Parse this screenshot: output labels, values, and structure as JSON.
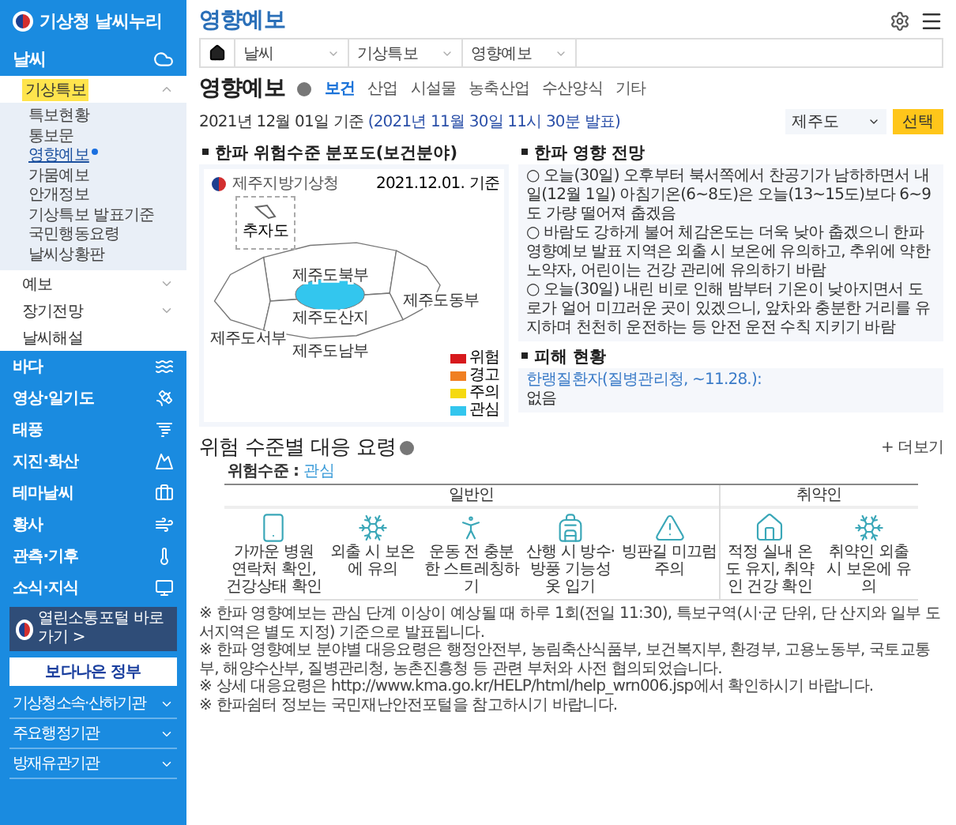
{
  "sidebar": {
    "logo": "기상청 날씨누리",
    "section": "날씨",
    "groups": [
      {
        "kind": "menu",
        "label": "기상특보",
        "expanded": true,
        "children": [
          {
            "label": "특보현황",
            "selected": false
          },
          {
            "label": "통보문",
            "selected": false
          },
          {
            "label": "영향예보",
            "selected": true
          },
          {
            "label": "가뭄예보",
            "selected": false
          },
          {
            "label": "안개정보",
            "selected": false
          },
          {
            "label": "기상특보 발표기준",
            "selected": false
          },
          {
            "label": "국민행동요령",
            "selected": false
          },
          {
            "label": "날씨상황판",
            "selected": false
          }
        ]
      },
      {
        "kind": "menu",
        "label": "예보",
        "expanded": false
      },
      {
        "kind": "menu",
        "label": "장기전망",
        "expanded": false
      },
      {
        "kind": "link",
        "label": "날씨해설"
      }
    ],
    "categories": [
      "바다",
      "영상·일기도",
      "태풍",
      "지진·화산",
      "테마날씨",
      "황사",
      "관측·기후",
      "소식·지식"
    ],
    "banners": [
      {
        "kind": "dark",
        "text": "열린소통포털 바로가기 >"
      },
      {
        "kind": "light",
        "text": "보다나은 정부"
      }
    ],
    "links": [
      "기상청소속·산하기관",
      "주요행정기관",
      "방재유관기관"
    ]
  },
  "main": {
    "page_title": "영향예보",
    "breadcrumb": [
      "날씨",
      "기상특보",
      "영향예보"
    ],
    "heading": "영향예보",
    "tabs": [
      {
        "label": "보건",
        "selected": true
      },
      {
        "label": "산업",
        "selected": false
      },
      {
        "label": "시설물",
        "selected": false
      },
      {
        "label": "농축산업",
        "selected": false
      },
      {
        "label": "수산양식",
        "selected": false
      },
      {
        "label": "기타",
        "selected": false
      }
    ],
    "date_basis": "2021년 12월 01일 기준",
    "issued": "(2021년 11월 30일 11시 30분 발표)",
    "region_select": {
      "value": "제주도"
    },
    "select_button": "선택",
    "map_panel": {
      "title": "한파 위험수준 분포도(보건분야)",
      "agency": "제주지방기상청",
      "date": "2021.12.01. 기준",
      "inset_label": "추자도",
      "regions": [
        {
          "label": "제주도북부",
          "color": "#ffffff"
        },
        {
          "label": "제주도동부",
          "color": "#ffffff"
        },
        {
          "label": "제주도산지",
          "color": "#33c6ee"
        },
        {
          "label": "제주도서부",
          "color": "#ffffff"
        },
        {
          "label": "제주도남부",
          "color": "#ffffff"
        }
      ],
      "legend": [
        {
          "label": "위험",
          "color": "#d7191c"
        },
        {
          "label": "경고",
          "color": "#f07f22"
        },
        {
          "label": "주의",
          "color": "#f5d90f"
        },
        {
          "label": "관심",
          "color": "#33c6ee"
        }
      ]
    },
    "outlook": {
      "title": "한파 영향 전망",
      "items": [
        "○ 오늘(30일) 오후부터 북서쪽에서 찬공기가 남하하면서 내일(12월 1일) 아침기온(6~8도)은 오늘(13~15도)보다 6~9도 가량 떨어져 춥겠음",
        "○ 바람도 강하게 불어 체감온도는 더욱 낮아 춥겠으니 한파 영향예보 발표 지역은 외출 시 보온에 유의하고, 추위에 약한 노약자, 어린이는 건강 관리에 유의하기 바람",
        "○ 오늘(30일) 내린 비로 인해 밤부터 기온이 낮아지면서 도로가 얼어 미끄러운 곳이 있겠으니, 앞차와 충분한 거리를 유지하며 천천히 운전하는 등 안전 운전 수칙 지키기 바람"
      ]
    },
    "damage": {
      "title": "피해 현황",
      "link": "한랭질환자(질병관리청, ~11.28.):",
      "value": "없음"
    },
    "guide": {
      "title": "위험 수준별 대응 요령",
      "more": "+ 더보기",
      "level_label": "위험수준 :",
      "level": "관심",
      "groups": [
        {
          "label": "일반인",
          "items": [
            "가까운 병원 연락처 확인, 건강상태 확인",
            "외출 시 보온에 유의",
            "운동 전 충분한 스트레칭하기",
            "산행 시 방수·방풍 기능성 옷 입기",
            "빙판길 미끄럼 주의"
          ]
        },
        {
          "label": "취약인",
          "items": [
            "적정 실내 온도 유지, 취약인 건강 확인",
            "취약인 외출 시 보온에 유의"
          ]
        }
      ]
    },
    "notes": [
      "※ 한파 영향예보는 관심 단계 이상이 예상될 때 하루 1회(전일 11:30), 특보구역(시·군 단위, 단 산지와 일부 도서지역은 별도 지정) 기준으로 발표됩니다.",
      "※ 한파 영향예보 분야별 대응요령은 행정안전부, 농림축산식품부, 보건복지부, 환경부, 고용노동부, 국토교통부, 해양수산부, 질병관리청, 농촌진흥청 등 관련 부처와 사전 협의되었습니다.",
      "※ 상세 대응요령은 http://www.kma.go.kr/HELP/html/help_wrn006.jsp에서 확인하시기 바랍니다.",
      "※ 한파쉼터 정보는 국민재난안전포털을 참고하시기 바랍니다."
    ]
  }
}
